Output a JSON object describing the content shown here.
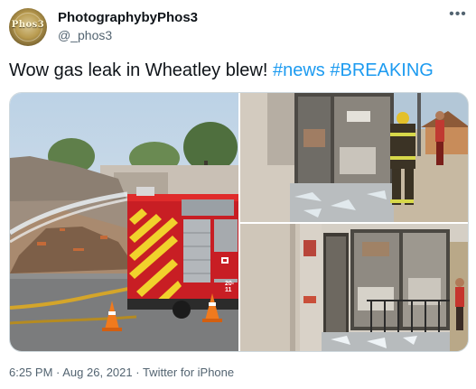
{
  "author": {
    "display_name": "PhotographybyPhos3",
    "handle": "@_phos3",
    "avatar_text": "Phos3"
  },
  "tweet": {
    "text": "Wow gas leak in Wheatley blew! ",
    "hashtags": [
      "#news",
      "#BREAKING"
    ]
  },
  "media": {
    "photos": [
      {
        "subject": "fire-truck-and-collapsed-building",
        "truck_label": "20-11"
      },
      {
        "subject": "firefighter-at-blown-storefront"
      },
      {
        "subject": "storefront-with-broken-glass"
      }
    ]
  },
  "meta": {
    "time": "6:25 PM",
    "separator": " · ",
    "date": "Aug 26, 2021",
    "source": "Twitter for iPhone"
  },
  "colors": {
    "link": "#1d9bf0",
    "text": "#0f1419",
    "secondary": "#536471"
  },
  "icons": {
    "more": "more-icon"
  }
}
